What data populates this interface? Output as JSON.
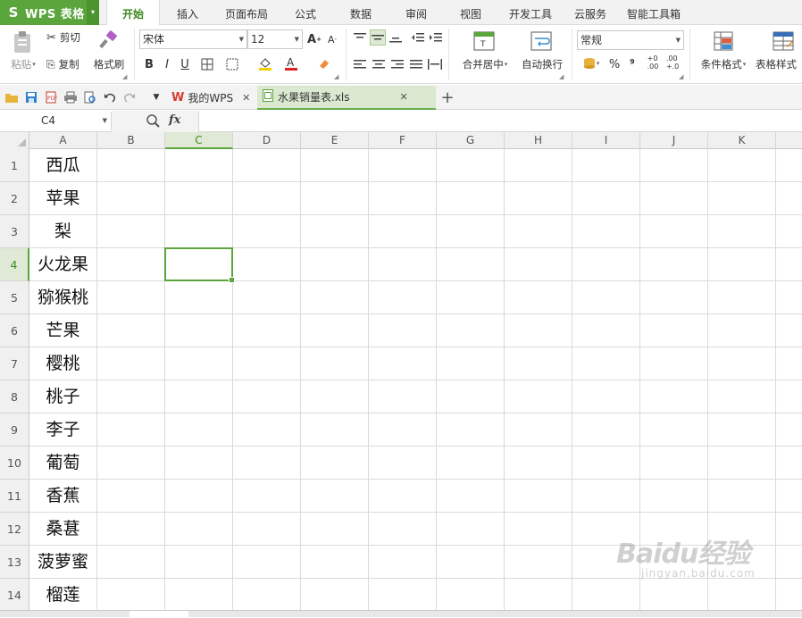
{
  "app": {
    "logo": "S",
    "name": "WPS 表格",
    "dropdown": "▾"
  },
  "menu": {
    "tabs": [
      {
        "label": "开始",
        "active": true
      },
      {
        "label": "插入"
      },
      {
        "label": "页面布局"
      },
      {
        "label": "公式"
      },
      {
        "label": "数据"
      },
      {
        "label": "审阅"
      },
      {
        "label": "视图"
      },
      {
        "label": "开发工具"
      },
      {
        "label": "云服务"
      },
      {
        "label": "智能工具箱"
      }
    ]
  },
  "ribbon": {
    "paste": "粘贴",
    "cut": "剪切",
    "copy": "复制",
    "format_painter": "格式刷",
    "font_name": "宋体",
    "font_size": "12",
    "bold": "B",
    "italic": "I",
    "underline": "U",
    "merge_center": "合并居中",
    "wrap_text": "自动换行",
    "number_format": "常规",
    "percent": "%",
    "comma": "⁹",
    "conditional_format": "条件格式",
    "table_style": "表格样式"
  },
  "quick_access": {
    "doc_tabs": [
      {
        "label": "我的WPS",
        "icon": "wps-logo-icon"
      },
      {
        "label": "水果销量表.xls",
        "icon": "spreadsheet-file-icon",
        "active": true
      }
    ],
    "new_tab": "+"
  },
  "formula_bar": {
    "name_box": "C4",
    "fx_label": "fx",
    "formula": ""
  },
  "sheet": {
    "columns": [
      "A",
      "B",
      "C",
      "D",
      "E",
      "F",
      "G",
      "H",
      "I",
      "J",
      "K"
    ],
    "selected_column": "C",
    "selected_row": 4,
    "rows": [
      {
        "n": "1",
        "A": "西瓜"
      },
      {
        "n": "2",
        "A": "苹果"
      },
      {
        "n": "3",
        "A": "梨"
      },
      {
        "n": "4",
        "A": "火龙果"
      },
      {
        "n": "5",
        "A": "猕猴桃"
      },
      {
        "n": "6",
        "A": "芒果"
      },
      {
        "n": "7",
        "A": "樱桃"
      },
      {
        "n": "8",
        "A": "桃子"
      },
      {
        "n": "9",
        "A": "李子"
      },
      {
        "n": "10",
        "A": "葡萄"
      },
      {
        "n": "11",
        "A": "香蕉"
      },
      {
        "n": "12",
        "A": "桑葚"
      },
      {
        "n": "13",
        "A": "菠萝蜜"
      },
      {
        "n": "14",
        "A": "榴莲"
      }
    ]
  },
  "watermark": {
    "brand": "Baidu经验",
    "url": "jingyan.baidu.com"
  },
  "colors": {
    "accent": "#5aa53c",
    "selection": "#5aa53c"
  }
}
